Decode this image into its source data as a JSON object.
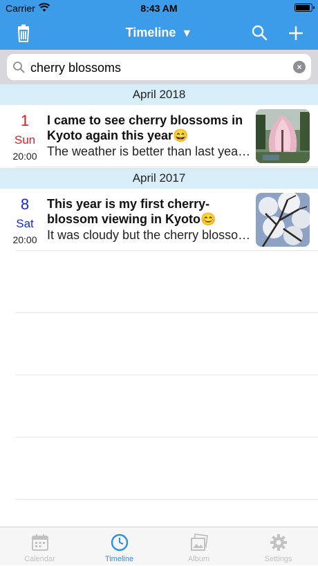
{
  "status_bar": {
    "carrier": "Carrier",
    "time": "8:43 AM",
    "battery_level": 0.92
  },
  "nav": {
    "title": "Timeline",
    "caret": "▼",
    "icons": [
      "trash-icon",
      "search-icon",
      "plus-icon"
    ]
  },
  "search": {
    "query": "cherry blossoms",
    "clear": "×"
  },
  "sections": [
    {
      "header": "April 2018",
      "entries": [
        {
          "day": "1",
          "weekday": "Sun",
          "time": "20:00",
          "title": "I came to see cherry blossoms in Kyoto again this year😄",
          "excerpt": "The weather is better than last year. The trees are",
          "day_color": "#e8161b"
        }
      ]
    },
    {
      "header": "April 2017",
      "entries": [
        {
          "day": "8",
          "weekday": "Sat",
          "time": "20:00",
          "title": "This year is my first cherry-blossom viewing in Kyoto😊",
          "excerpt": "It was cloudy but the cherry blossoms were beautiful",
          "day_color": "#1428d8"
        }
      ]
    }
  ],
  "tabs": [
    {
      "label": "Calendar",
      "icon": "calendar-icon",
      "active": false
    },
    {
      "label": "Timeline",
      "icon": "clock-icon",
      "active": true
    },
    {
      "label": "Album",
      "icon": "album-icon",
      "active": false
    },
    {
      "label": "Settings",
      "icon": "gear-icon",
      "active": false
    }
  ],
  "colors": {
    "accent": "#3d9cea",
    "section_bg": "#d7eef9",
    "sunday": "#e8161b",
    "saturday": "#1428d8",
    "tab_active": "#2e8fe0",
    "tab_inactive": "#c2c2c2"
  }
}
